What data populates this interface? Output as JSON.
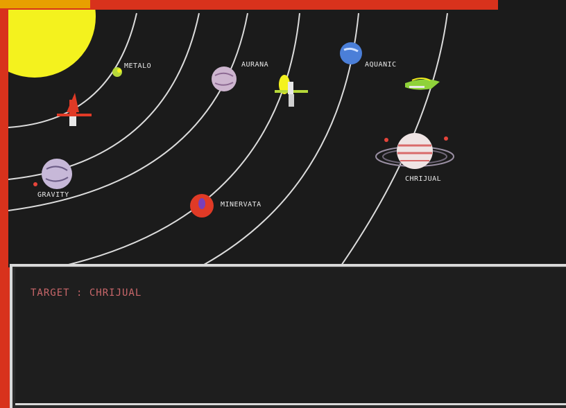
{
  "colors": {
    "border_red": "#d8321c",
    "space_bg": "#1b1b1b",
    "orbit_line": "#dcdcdc",
    "sun_yellow": "#f4f21e",
    "label_text": "#e8e8e8",
    "message_text": "#c9676a",
    "panel_border": "#d9d9d9"
  },
  "planets": [
    {
      "name": "METALO",
      "icon": "small-green-planet-icon"
    },
    {
      "name": "AURANA",
      "icon": "pink-planet-icon"
    },
    {
      "name": "AQUANIC",
      "icon": "blue-planet-icon"
    },
    {
      "name": "GRAVITY",
      "icon": "lavender-planet-icon"
    },
    {
      "name": "MINERVATA",
      "icon": "red-planet-icon"
    },
    {
      "name": "CHRIJUAL",
      "icon": "ringed-planet-icon"
    }
  ],
  "ships": [
    {
      "icon": "red-rocket-ship-icon"
    },
    {
      "icon": "yellow-rocket-ship-icon"
    },
    {
      "icon": "green-spaceship-icon"
    }
  ],
  "message": {
    "text": "TARGET : CHRIJUAL"
  }
}
